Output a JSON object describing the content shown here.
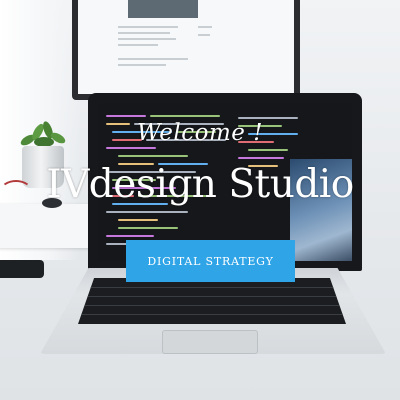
{
  "hero": {
    "welcome_text": "Welcome !",
    "title": "IVdesign Studio",
    "cta_label": "DIGITAL STRATEGY"
  },
  "colors": {
    "cta_background": "#2fa4e7",
    "overlay_text": "#ffffff"
  },
  "icons": {
    "background_photo": "laptop-on-desk-photo"
  }
}
